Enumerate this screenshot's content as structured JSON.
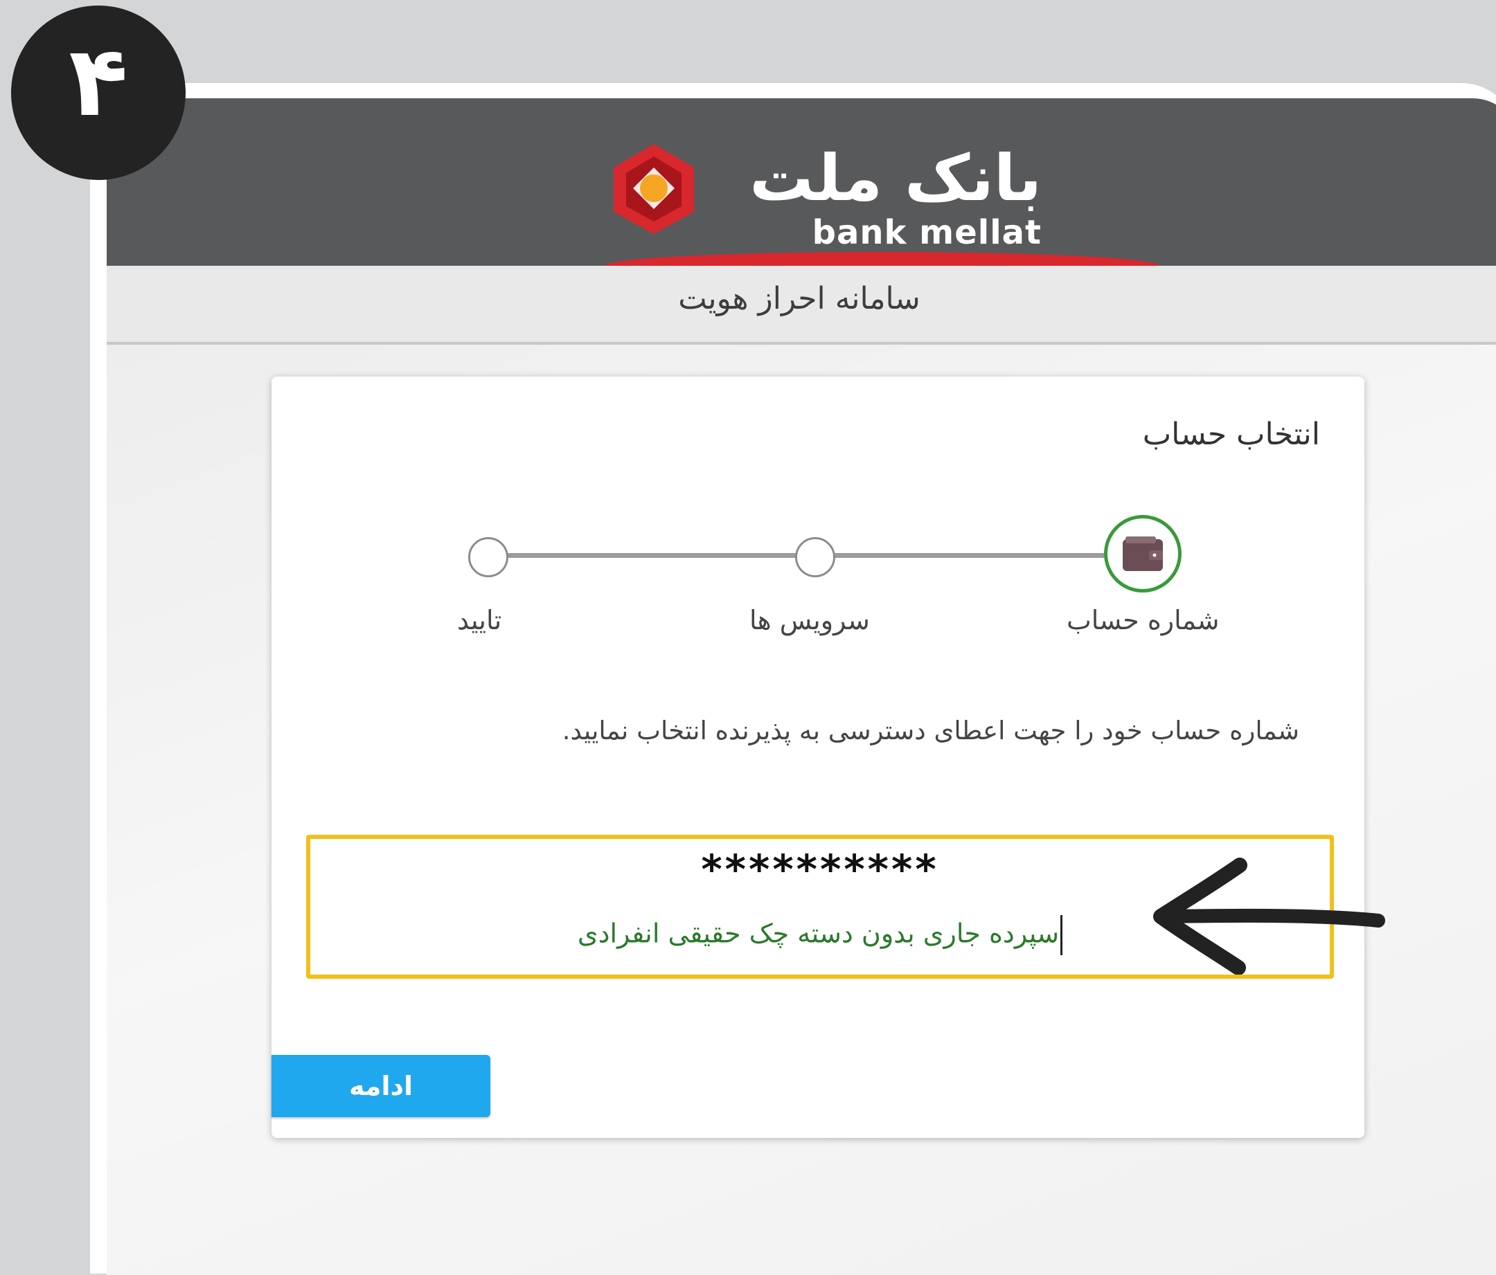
{
  "badge": {
    "number": "۴"
  },
  "header": {
    "logo_fa": "بانک ملت",
    "logo_en": "bank mellat",
    "subtitle": "سامانه احراز هویت"
  },
  "card": {
    "title": "انتخاب حساب",
    "steps": [
      {
        "label": "شماره حساب",
        "state": "active",
        "icon": "wallet-icon"
      },
      {
        "label": "سرویس ها",
        "state": "pending"
      },
      {
        "label": "تایید",
        "state": "pending"
      }
    ],
    "instruction": "شماره حساب خود را جهت اعطای دسترسی به پذیرنده انتخاب نمایید.",
    "account": {
      "number": "**********",
      "type": "سپرده جاری بدون دسته چک حقیقی انفرادی"
    },
    "continue_label": "ادامه"
  },
  "colors": {
    "header_bg": "#58595b",
    "highlight_border": "#f3bf1a",
    "button_bg": "#20a8ef",
    "active_step": "#3a9a3a",
    "account_type_text": "#2b7a2b"
  }
}
